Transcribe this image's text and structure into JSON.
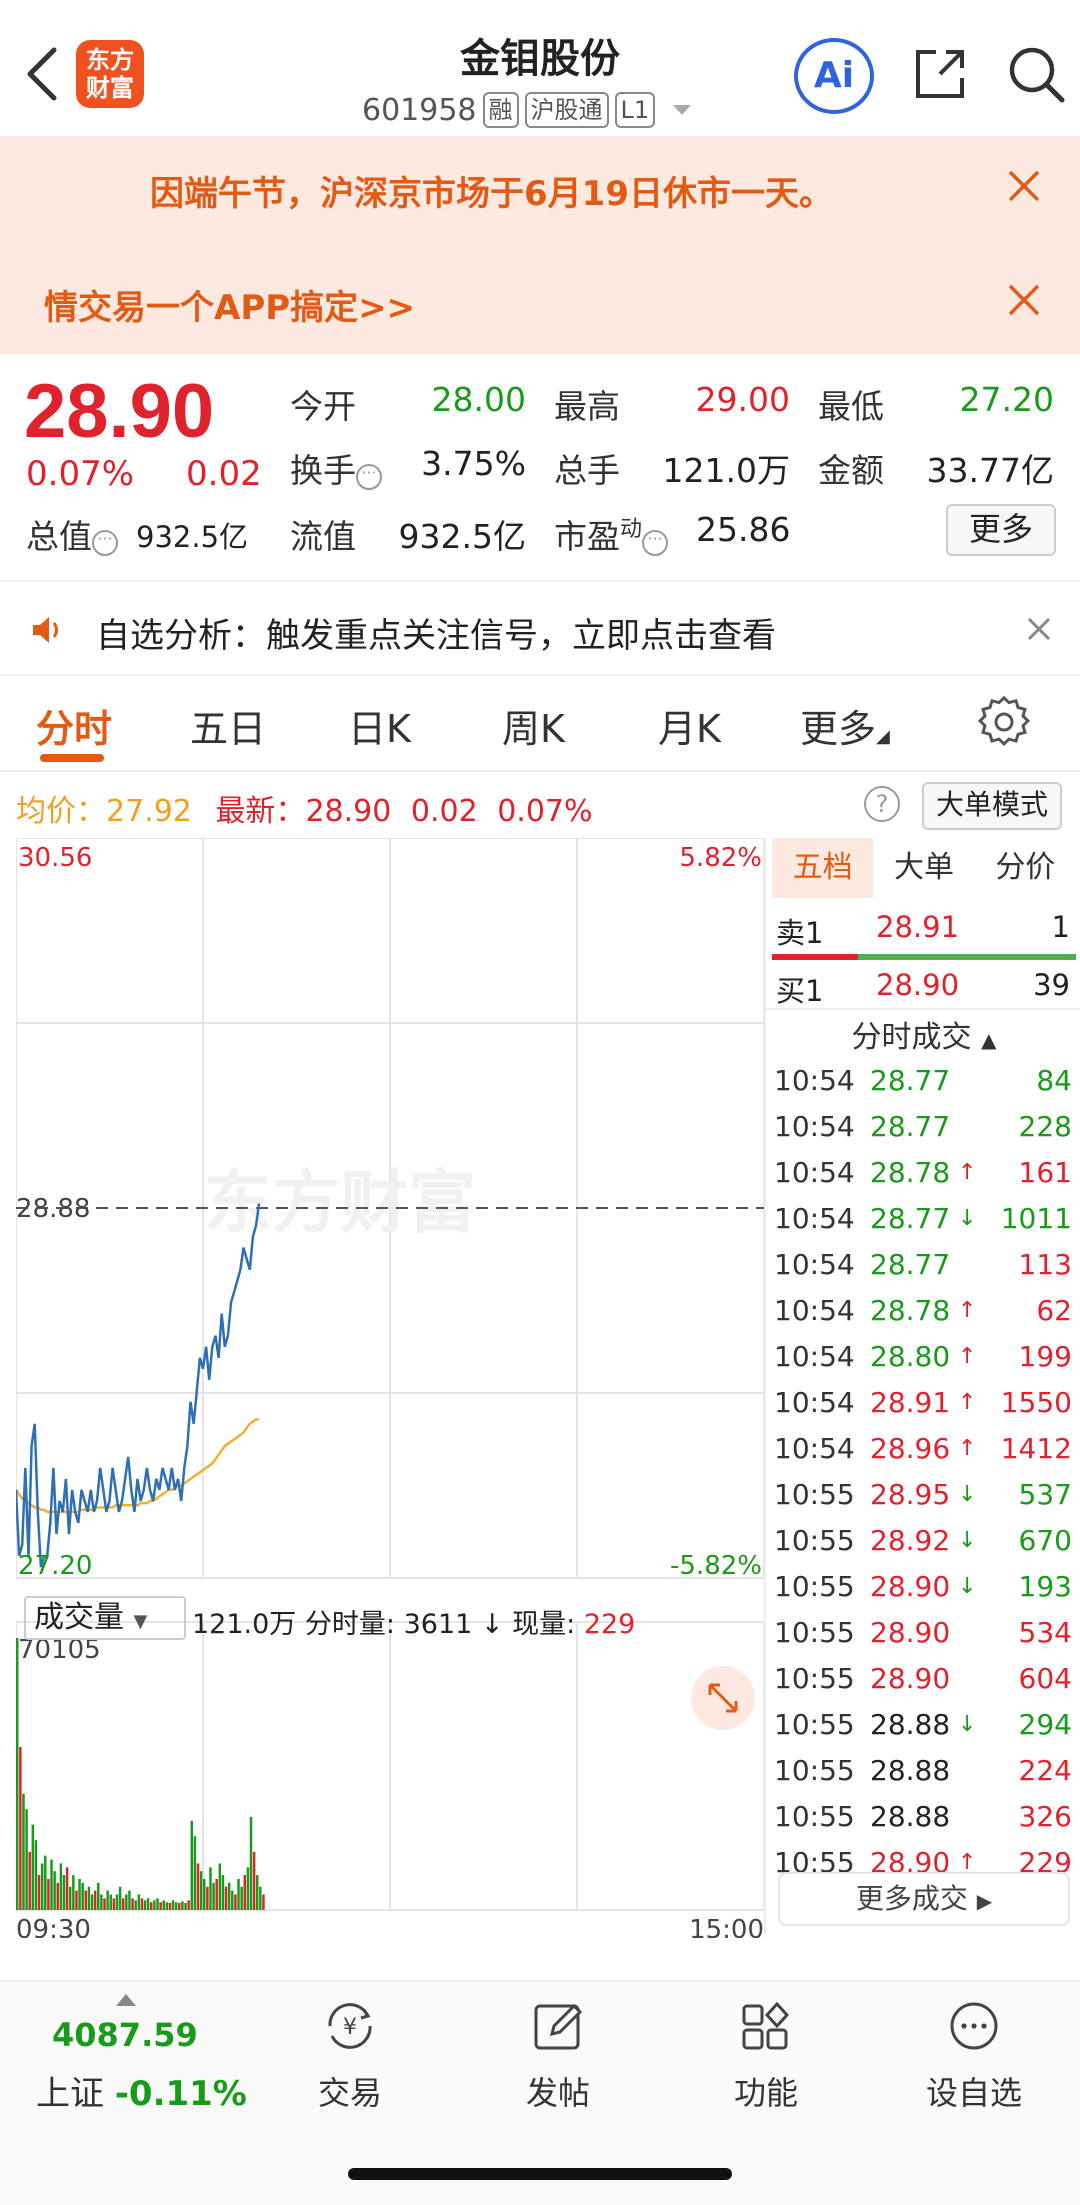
{
  "header": {
    "logo_text": "东方财富",
    "stock_name": "金钼股份",
    "stock_code": "601958",
    "tags": [
      "融",
      "沪股通",
      "L1"
    ],
    "ai_label": "Ai"
  },
  "banners": {
    "holiday_notice": "因端午节，沪深京市场于6月19日休市一天。",
    "promo": "情交易一个APP搞定>>"
  },
  "quote": {
    "price": "28.90",
    "change_pct": "0.07%",
    "change": "0.02",
    "open_label": "今开",
    "open": "28.00",
    "high_label": "最高",
    "high": "29.00",
    "low_label": "最低",
    "low": "27.20",
    "turnover_label": "换手",
    "turnover": "3.75%",
    "volume_label": "总手",
    "volume": "121.0万",
    "amount_label": "金额",
    "amount": "33.77亿",
    "mktcap_label": "总值",
    "mktcap": "932.5亿",
    "float_label": "流值",
    "float_cap": "932.5亿",
    "pe_label": "市盈",
    "pe_sup": "动",
    "pe": "25.86",
    "more_label": "更多"
  },
  "alert": {
    "text": "自选分析：触发重点关注信号，立即点击查看"
  },
  "tabs": [
    "分时",
    "五日",
    "日K",
    "周K",
    "月K",
    "更多"
  ],
  "avg_row": {
    "avg_label": "均价：",
    "avg": "27.92",
    "latest_label": "最新：",
    "latest": "28.90",
    "chg": "0.02",
    "pct": "0.07%",
    "help": "?",
    "bigorder_label": "大单模式"
  },
  "colors": {
    "up": "#e0222c",
    "down": "#1a9a1a",
    "price_line": "#2e6fb5",
    "avg_line": "#f0b030",
    "accent": "#e35a15"
  },
  "chart_data": {
    "type": "line",
    "ylim": [
      27.2,
      30.56
    ],
    "y_top_label": "30.56",
    "y_bottom_label": "27.20",
    "pct_top_label": "5.82%",
    "pct_bottom_label": "-5.82%",
    "prev_close": 28.88,
    "prev_close_label": "28.88",
    "watermark": "东方财富",
    "x_start_label": "09:30",
    "x_end_label": "15:00",
    "total_points": 241,
    "series": [
      {
        "values": [
          27.6,
          27.3,
          27.35,
          27.7,
          27.3,
          27.8,
          27.9,
          27.5,
          27.25,
          27.3,
          27.3,
          27.45,
          27.7,
          27.4,
          27.55,
          27.5,
          27.65,
          27.4,
          27.6,
          27.5,
          27.45,
          27.6,
          27.55,
          27.5,
          27.6,
          27.5,
          27.55,
          27.7,
          27.6,
          27.5,
          27.55,
          27.7,
          27.6,
          27.5,
          27.55,
          27.65,
          27.75,
          27.6,
          27.5,
          27.65,
          27.55,
          27.6,
          27.7,
          27.6,
          27.55,
          27.65,
          27.6,
          27.7,
          27.65,
          27.6,
          27.7,
          27.6,
          27.65,
          27.55,
          27.7,
          27.8,
          28.0,
          27.9,
          28.05,
          28.2,
          28.15,
          28.25,
          28.1,
          28.25,
          28.3,
          28.2,
          28.4,
          28.25,
          28.3,
          28.45,
          28.5,
          28.55,
          28.6,
          28.7,
          28.65,
          28.6,
          28.75,
          28.8,
          28.9
        ]
      },
      {
        "values": [
          27.6,
          27.58,
          27.56,
          27.55,
          27.54,
          27.53,
          27.52,
          27.52,
          27.51,
          27.51,
          27.5,
          27.5,
          27.5,
          27.5,
          27.5,
          27.5,
          27.5,
          27.5,
          27.5,
          27.5,
          27.5,
          27.51,
          27.51,
          27.51,
          27.51,
          27.51,
          27.52,
          27.52,
          27.52,
          27.52,
          27.52,
          27.52,
          27.53,
          27.53,
          27.53,
          27.53,
          27.53,
          27.53,
          27.53,
          27.53,
          27.54,
          27.54,
          27.54,
          27.55,
          27.55,
          27.56,
          27.57,
          27.58,
          27.59,
          27.6,
          27.6,
          27.61,
          27.62,
          27.62,
          27.63,
          27.64,
          27.65,
          27.66,
          27.67,
          27.68,
          27.69,
          27.7,
          27.71,
          27.72,
          27.74,
          27.76,
          27.78,
          27.8,
          27.81,
          27.82,
          27.83,
          27.84,
          27.85,
          27.86,
          27.88,
          27.9,
          27.91,
          27.92,
          27.92
        ]
      }
    ]
  },
  "volume": {
    "select_label": "成交量",
    "total": "121.0万",
    "minute_label": "分时量:",
    "minute": "3611",
    "now_label": "现量:",
    "now": "229",
    "max_label": "70105",
    "bars": [
      70105,
      42000,
      30000,
      26000,
      15000,
      22000,
      18000,
      9000,
      12000,
      14000,
      8000,
      13000,
      10000,
      7000,
      12000,
      9000,
      11000,
      6000,
      9000,
      5000,
      8000,
      7000,
      5000,
      6000,
      4000,
      5000,
      7000,
      4000,
      3000,
      5000,
      4000,
      3000,
      4000,
      6000,
      3000,
      4000,
      5000,
      3000,
      2500,
      4000,
      3000,
      2500,
      3000,
      2000,
      2500,
      3000,
      2000,
      2500,
      2000,
      1800,
      2500,
      2000,
      1800,
      2200,
      1800,
      2500,
      23000,
      19000,
      12000,
      10000,
      8000,
      6000,
      11000,
      7000,
      8000,
      12000,
      9000,
      6000,
      7000,
      5000,
      4000,
      8000,
      6000,
      9000,
      11000,
      24000,
      15000,
      9000,
      6000,
      4000
    ],
    "bar_colors_pattern": "alternating"
  },
  "panel": {
    "tabs": [
      "五档",
      "大单",
      "分价"
    ],
    "sell": {
      "label": "卖1",
      "price": "28.91",
      "qty": "1"
    },
    "buy": {
      "label": "买1",
      "price": "28.90",
      "qty": "39"
    },
    "trades_title": "分时成交",
    "trades": [
      {
        "time": "10:54",
        "price": "28.77",
        "pc": "green",
        "arrow": "",
        "qty": "84",
        "qc": "green"
      },
      {
        "time": "10:54",
        "price": "28.77",
        "pc": "green",
        "arrow": "",
        "qty": "228",
        "qc": "green"
      },
      {
        "time": "10:54",
        "price": "28.78",
        "pc": "green",
        "arrow": "↑",
        "qty": "161",
        "qc": "red"
      },
      {
        "time": "10:54",
        "price": "28.77",
        "pc": "green",
        "arrow": "↓",
        "qty": "1011",
        "qc": "green"
      },
      {
        "time": "10:54",
        "price": "28.77",
        "pc": "green",
        "arrow": "",
        "qty": "113",
        "qc": "red"
      },
      {
        "time": "10:54",
        "price": "28.78",
        "pc": "green",
        "arrow": "↑",
        "qty": "62",
        "qc": "red"
      },
      {
        "time": "10:54",
        "price": "28.80",
        "pc": "green",
        "arrow": "↑",
        "qty": "199",
        "qc": "red"
      },
      {
        "time": "10:54",
        "price": "28.91",
        "pc": "red",
        "arrow": "↑",
        "qty": "1550",
        "qc": "red"
      },
      {
        "time": "10:54",
        "price": "28.96",
        "pc": "red",
        "arrow": "↑",
        "qty": "1412",
        "qc": "red"
      },
      {
        "time": "10:55",
        "price": "28.95",
        "pc": "red",
        "arrow": "↓",
        "qty": "537",
        "qc": "green"
      },
      {
        "time": "10:55",
        "price": "28.92",
        "pc": "red",
        "arrow": "↓",
        "qty": "670",
        "qc": "green"
      },
      {
        "time": "10:55",
        "price": "28.90",
        "pc": "red",
        "arrow": "↓",
        "qty": "193",
        "qc": "green"
      },
      {
        "time": "10:55",
        "price": "28.90",
        "pc": "red",
        "arrow": "",
        "qty": "534",
        "qc": "red"
      },
      {
        "time": "10:55",
        "price": "28.90",
        "pc": "red",
        "arrow": "",
        "qty": "604",
        "qc": "red"
      },
      {
        "time": "10:55",
        "price": "28.88",
        "pc": "black",
        "arrow": "↓",
        "qty": "294",
        "qc": "green"
      },
      {
        "time": "10:55",
        "price": "28.88",
        "pc": "black",
        "arrow": "",
        "qty": "224",
        "qc": "red"
      },
      {
        "time": "10:55",
        "price": "28.88",
        "pc": "black",
        "arrow": "",
        "qty": "326",
        "qc": "red"
      },
      {
        "time": "10:55",
        "price": "28.90",
        "pc": "red",
        "arrow": "↑",
        "qty": "229",
        "qc": "red"
      }
    ],
    "more_trades": "更多成交"
  },
  "bottom_nav": {
    "index_value": "4087.59",
    "index_name": "上证",
    "index_pct": "-0.11%",
    "items": [
      {
        "label": "交易",
        "icon": "trade-icon"
      },
      {
        "label": "发帖",
        "icon": "post-icon"
      },
      {
        "label": "功能",
        "icon": "apps-icon"
      },
      {
        "label": "设自选",
        "icon": "more-dots-icon"
      }
    ]
  }
}
